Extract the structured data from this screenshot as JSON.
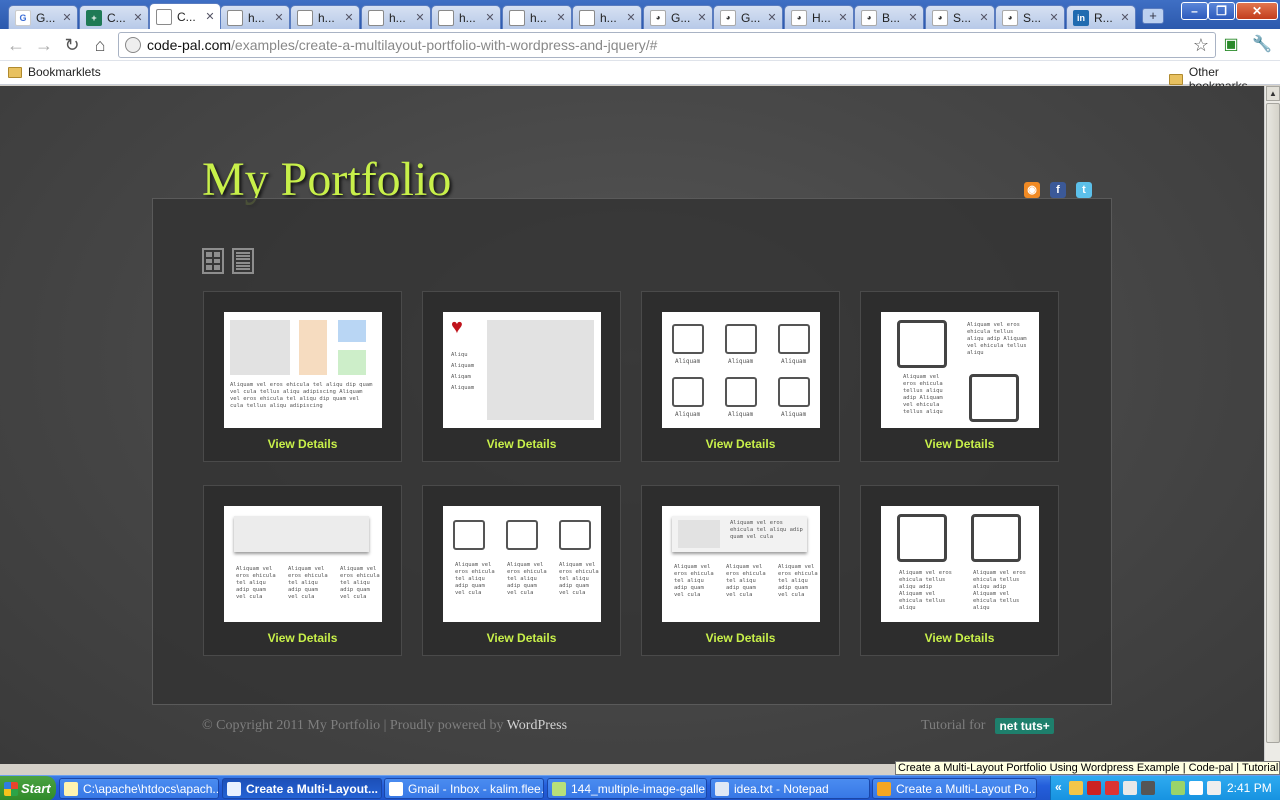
{
  "browser": {
    "tabs": [
      {
        "label": "G...",
        "favicon": "google",
        "active": false
      },
      {
        "label": "C...",
        "favicon": "green",
        "active": false
      },
      {
        "label": "C...",
        "favicon": "doc",
        "active": true
      },
      {
        "label": "h...",
        "favicon": "doc",
        "active": false
      },
      {
        "label": "h...",
        "favicon": "doc",
        "active": false
      },
      {
        "label": "h...",
        "favicon": "doc",
        "active": false
      },
      {
        "label": "h...",
        "favicon": "doc",
        "active": false
      },
      {
        "label": "h...",
        "favicon": "doc",
        "active": false
      },
      {
        "label": "h...",
        "favicon": "doc",
        "active": false
      },
      {
        "label": "G...",
        "favicon": "reddit",
        "active": false
      },
      {
        "label": "G...",
        "favicon": "reddit",
        "active": false
      },
      {
        "label": "H...",
        "favicon": "reddit",
        "active": false
      },
      {
        "label": "B...",
        "favicon": "reddit",
        "active": false
      },
      {
        "label": "S...",
        "favicon": "reddit",
        "active": false
      },
      {
        "label": "S...",
        "favicon": "reddit",
        "active": false
      },
      {
        "label": "R...",
        "favicon": "linkedin",
        "active": false
      }
    ],
    "url_domain": "code-pal.com",
    "url_path": "/examples/create-a-multilayout-portfolio-with-wordpress-and-jquery/#",
    "bookmarks_left": "Bookmarklets",
    "bookmarks_right": "Other bookmarks",
    "status_tooltip": "Create a Multi-Layout Portfolio Using Wordpress Example | Code-pal | Tutorial f"
  },
  "site": {
    "title": "My Portfolio",
    "social": [
      "rss-icon",
      "facebook-icon",
      "twitter-icon"
    ],
    "view_details_label": "View Details",
    "footer_copyright": "© Copyright 2011 My Portfolio | Proudly powered by ",
    "footer_wordpress": "WordPress",
    "footer_tutorial": "Tutorial for",
    "footer_brand": "net tuts+",
    "colors": {
      "accent": "#c8f04a",
      "background": "#4a4a4a",
      "panel": "#343434"
    },
    "thumb_text": {
      "lorem": "Aliquam vel eros ehicula tel aliqu dip quam vel cula tellus aliqu adipiscing Aliquam vel eros ehicula tel aliqu dip quam vel cula tellus aliqu adipiscing",
      "short_list": [
        "Aliqu",
        "Aliquam",
        "Aliqam",
        "Aliquam"
      ],
      "caption": "Aliquam",
      "col": "Aliquam vel eros ehicula tel aliqu adip quam vel cula",
      "col2": "Aliquam vel eros ehicula tellus aliqu adip Aliquam vel ehicula tellus aliqu"
    }
  },
  "taskbar": {
    "start_label": "Start",
    "tasks": [
      {
        "label": "C:\\apache\\htdocs\\apach...",
        "active": false
      },
      {
        "label": "Create a Multi-Layout...",
        "active": true
      },
      {
        "label": "Gmail - Inbox - kalim.flee...",
        "active": false
      },
      {
        "label": "144_multiple-image-galle...",
        "active": false
      },
      {
        "label": "idea.txt - Notepad",
        "active": false
      },
      {
        "label": "Create a Multi-Layout Po...",
        "active": false
      }
    ],
    "clock": "2:41 PM"
  }
}
